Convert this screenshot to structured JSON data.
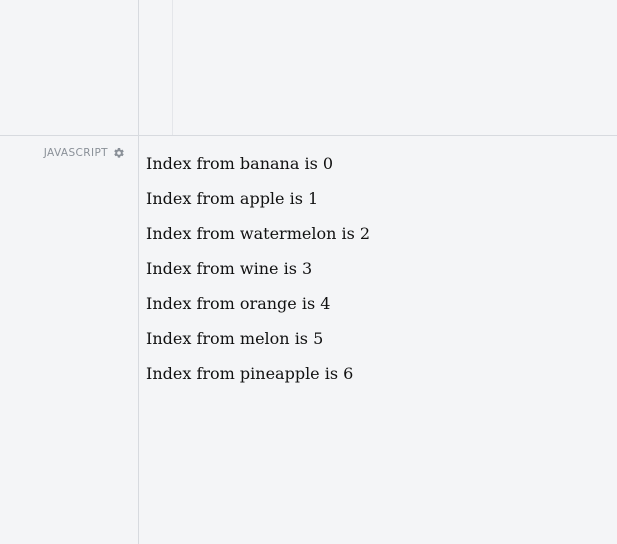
{
  "panel": {
    "label": "JAVASCRIPT",
    "settings_icon": "gear-icon"
  },
  "console": {
    "lines": [
      "Index from banana is 0",
      "Index from apple is 1",
      "Index from watermelon is 2",
      "Index from wine is 3",
      "Index from orange is 4",
      "Index from melon is 5",
      "Index from pineapple is 6"
    ]
  },
  "colors": {
    "background": "#f4f5f7",
    "divider": "#d7dadf",
    "label": "#8a9098",
    "text": "#111111"
  }
}
